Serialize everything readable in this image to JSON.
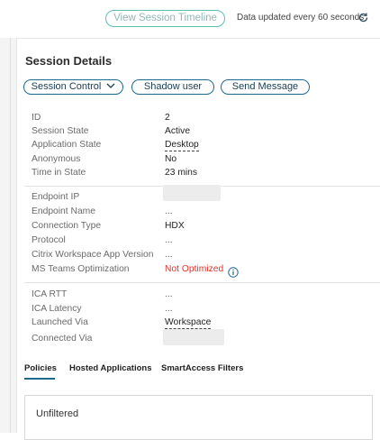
{
  "topbar": {
    "timeline_button": "View Session Timeline",
    "updated_text": "Data updated every 60 seconds"
  },
  "panel": {
    "title": "Session Details",
    "buttons": {
      "session_control": "Session Control",
      "shadow_user": "Shadow user",
      "send_message": "Send Message"
    },
    "group1": [
      {
        "label": "ID",
        "value": "2"
      },
      {
        "label": "Session State",
        "value": "Active"
      },
      {
        "label": "Application State",
        "value": "Desktop"
      },
      {
        "label": "Anonymous",
        "value": "No"
      },
      {
        "label": "Time in State",
        "value": "23 mins"
      }
    ],
    "group2": [
      {
        "label": "Endpoint IP",
        "value": ""
      },
      {
        "label": "Endpoint Name",
        "value": "..."
      },
      {
        "label": "Connection Type",
        "value": "HDX"
      },
      {
        "label": "Protocol",
        "value": "..."
      },
      {
        "label": "Citrix Workspace App Version",
        "value": "..."
      },
      {
        "label": "MS Teams Optimization",
        "value": "Not Optimized"
      }
    ],
    "group3": [
      {
        "label": "ICA RTT",
        "value": "..."
      },
      {
        "label": "ICA Latency",
        "value": "..."
      },
      {
        "label": "Launched Via",
        "value": "Workspace"
      },
      {
        "label": "Connected Via",
        "value": ""
      }
    ],
    "tabs": [
      "Policies",
      "Hosted Applications",
      "SmartAccess Filters"
    ],
    "filter_text": "Unfiltered"
  },
  "colors": {
    "accent": "#1d6a8e",
    "timeline_border": "#5bbfb7",
    "warning_red": "#e0352b"
  }
}
